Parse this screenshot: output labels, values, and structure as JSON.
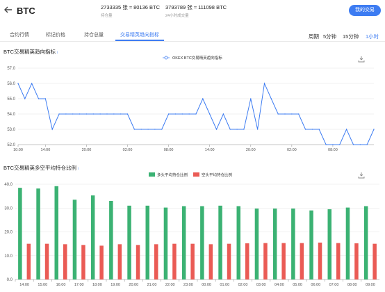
{
  "header": {
    "title": "BTC",
    "open_interest_value": "2733335 张 ≈ 80136 BTC",
    "open_interest_label": "持仓量",
    "volume_value": "3793789 张 ≈ 111098 BTC",
    "volume_label": "24小时成交量",
    "buy_label": "我的交易"
  },
  "tabs": [
    "合约行情",
    "标记价格",
    "持仓总量",
    "交易精英趋向指标"
  ],
  "active_tab": 3,
  "period": {
    "label": "周期",
    "options": [
      "5分钟",
      "15分钟",
      "1小时"
    ],
    "active": 2
  },
  "chart1": {
    "title": "BTC交易精英趋向指标",
    "info_icon": "i",
    "download_icon": "download-icon"
  },
  "chart2": {
    "title": "BTC交易精英多空平均持仓比例",
    "info_icon": "i",
    "download_icon": "download-icon"
  },
  "chart_data": [
    {
      "type": "line",
      "title": "",
      "series": [
        {
          "name": "OKEX BTC交易精英趋向指标",
          "color": "#3d7cf2",
          "values": [
            56.0,
            55.0,
            56.0,
            55.0,
            55.0,
            53.0,
            54.0,
            54.0,
            54.0,
            54.0,
            54.0,
            54.0,
            54.0,
            54.0,
            54.0,
            54.0,
            54.0,
            53.0,
            53.0,
            53.0,
            53.0,
            53.0,
            54.0,
            54.0,
            54.0,
            54.0,
            54.0,
            55.0,
            54.0,
            53.0,
            54.0,
            53.0,
            53.0,
            53.0,
            55.0,
            53.0,
            56.0,
            55.0,
            54.0,
            54.0,
            54.0,
            54.0,
            53.0,
            53.0,
            53.0,
            52.0,
            52.0,
            52.0,
            53.0,
            52.0,
            52.0,
            52.0,
            53.0
          ]
        }
      ],
      "x_tick_labels": [
        "10:00",
        "14:00",
        "20:00",
        "02:00",
        "08:00",
        "14:00",
        "20:00",
        "02:00",
        "08:00"
      ],
      "x_tick_index": [
        0,
        4,
        10,
        16,
        22,
        28,
        34,
        40,
        46
      ],
      "y_ticks": [
        52.0,
        53.0,
        54.0,
        55.0,
        56.0,
        57.0
      ],
      "ylim": [
        52.0,
        57.0
      ],
      "grid": true,
      "legend": "top-center"
    },
    {
      "type": "bar",
      "title": "",
      "categories": [
        "14:00",
        "15:00",
        "16:00",
        "17:00",
        "18:00",
        "19:00",
        "20:00",
        "21:00",
        "22:00",
        "23:00",
        "00:00",
        "01:00",
        "02:00",
        "03:00",
        "04:00",
        "05:00",
        "06:00",
        "07:00",
        "08:00",
        "09:00"
      ],
      "series": [
        {
          "name": "多头平均持仓比例",
          "color": "#3bb273",
          "values": [
            38.5,
            38.2,
            39.2,
            33.5,
            35.3,
            33.0,
            31.0,
            31.0,
            30.2,
            30.8,
            30.8,
            31.0,
            30.8,
            29.8,
            29.8,
            29.8,
            29.0,
            29.5,
            30.2,
            30.8
          ]
        },
        {
          "name": "空头平均持仓比例",
          "color": "#ea5b55",
          "values": [
            15.0,
            15.0,
            14.8,
            14.5,
            14.2,
            14.8,
            14.5,
            14.8,
            15.0,
            15.0,
            14.8,
            15.0,
            15.2,
            15.3,
            15.3,
            15.3,
            15.5,
            15.3,
            15.2,
            15.0
          ]
        }
      ],
      "y_ticks": [
        0.0,
        10.0,
        20.0,
        30.0,
        40.0
      ],
      "ylim": [
        0,
        40
      ],
      "grid": true,
      "legend": "top-center"
    }
  ]
}
